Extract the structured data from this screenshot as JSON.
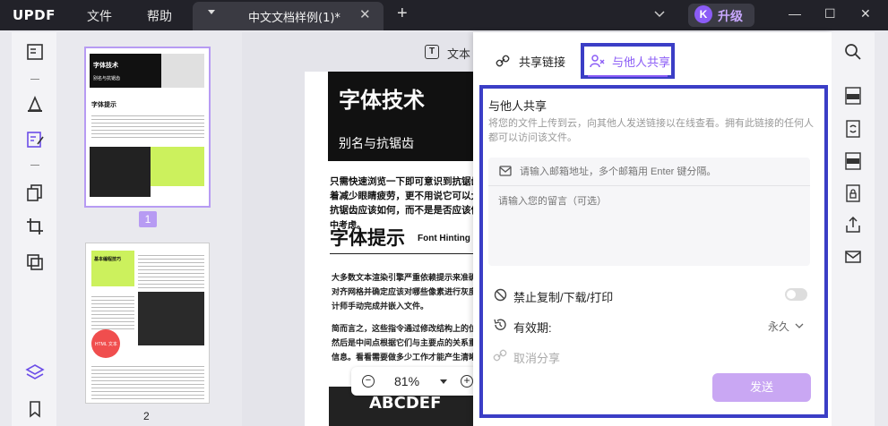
{
  "app": {
    "logo_main": "UPDF",
    "menu_file": "文件",
    "menu_help": "帮助",
    "tab_title": "中文文档样例(1)*",
    "tab_close": "✕",
    "tab_add": "+",
    "avatar_letter": "K",
    "upgrade_label": "升级",
    "win_minimize": "—",
    "win_maximize": "☐",
    "win_close": "✕"
  },
  "thumbnails": {
    "page1_number": "1",
    "page2_number": "2",
    "page1_title": "字体技术",
    "page1_sub": "别名与抗锯齿",
    "page1_h2": "字体提示",
    "page2_title": "基本编程技巧",
    "page2_html": "HTML 文本"
  },
  "document": {
    "toolbar_text": "文本",
    "toolbar_icon": "T",
    "heading": "字体技术",
    "subheading": "别名与抗锯齿",
    "para1": [
      "只需快速浏览一下即可意识到抗锯齿有",
      "着减少眼睛疲劳，更不用说它可以大量",
      "抗锯齿应该如何，而不是是否应该使用",
      "中考虑。"
    ],
    "h2": "字体提示",
    "h2_en": "Font Hinting",
    "para2": [
      "大多数文本渲染引擎严重依赖提示来准确确定",
      "对齐网格并确定应该对哪些像素进行灰度化。",
      "计师手动完成并嵌入文件。"
    ],
    "para3": [
      "简而言之，这些指令通过修改结构上的位置来",
      "然后是中间点根据它们与主要点的关系重新定",
      "信息。看看需要做多少工作才能产生清晰的节"
    ],
    "image_text": "ABCDEF"
  },
  "zoom": {
    "minus": "−",
    "value": "81%",
    "plus": "+"
  },
  "share_panel": {
    "tab_link": "共享链接",
    "tab_share": "与他人共享",
    "title": "与他人共享",
    "description": "将您的文件上传到云，向其他人发送链接以在线查看。拥有此链接的任何人都可以访问该文件。",
    "email_placeholder": "请输入邮箱地址，多个邮箱用 Enter 键分隔。",
    "message_placeholder": "请输入您的留言（可选）",
    "disable_copy_label": "禁止复制/下载/打印",
    "disable_copy_enabled": false,
    "expiry_label": "有效期:",
    "expiry_value": "永久",
    "cancel_share_label": "取消分享",
    "send_label": "发送"
  },
  "colors": {
    "accent_purple": "#8b5cf6",
    "highlight_border": "#3b3ec6",
    "send_button": "#c9a7f3",
    "titlebar": "#222229",
    "logo_accent": "#f5b94a"
  }
}
